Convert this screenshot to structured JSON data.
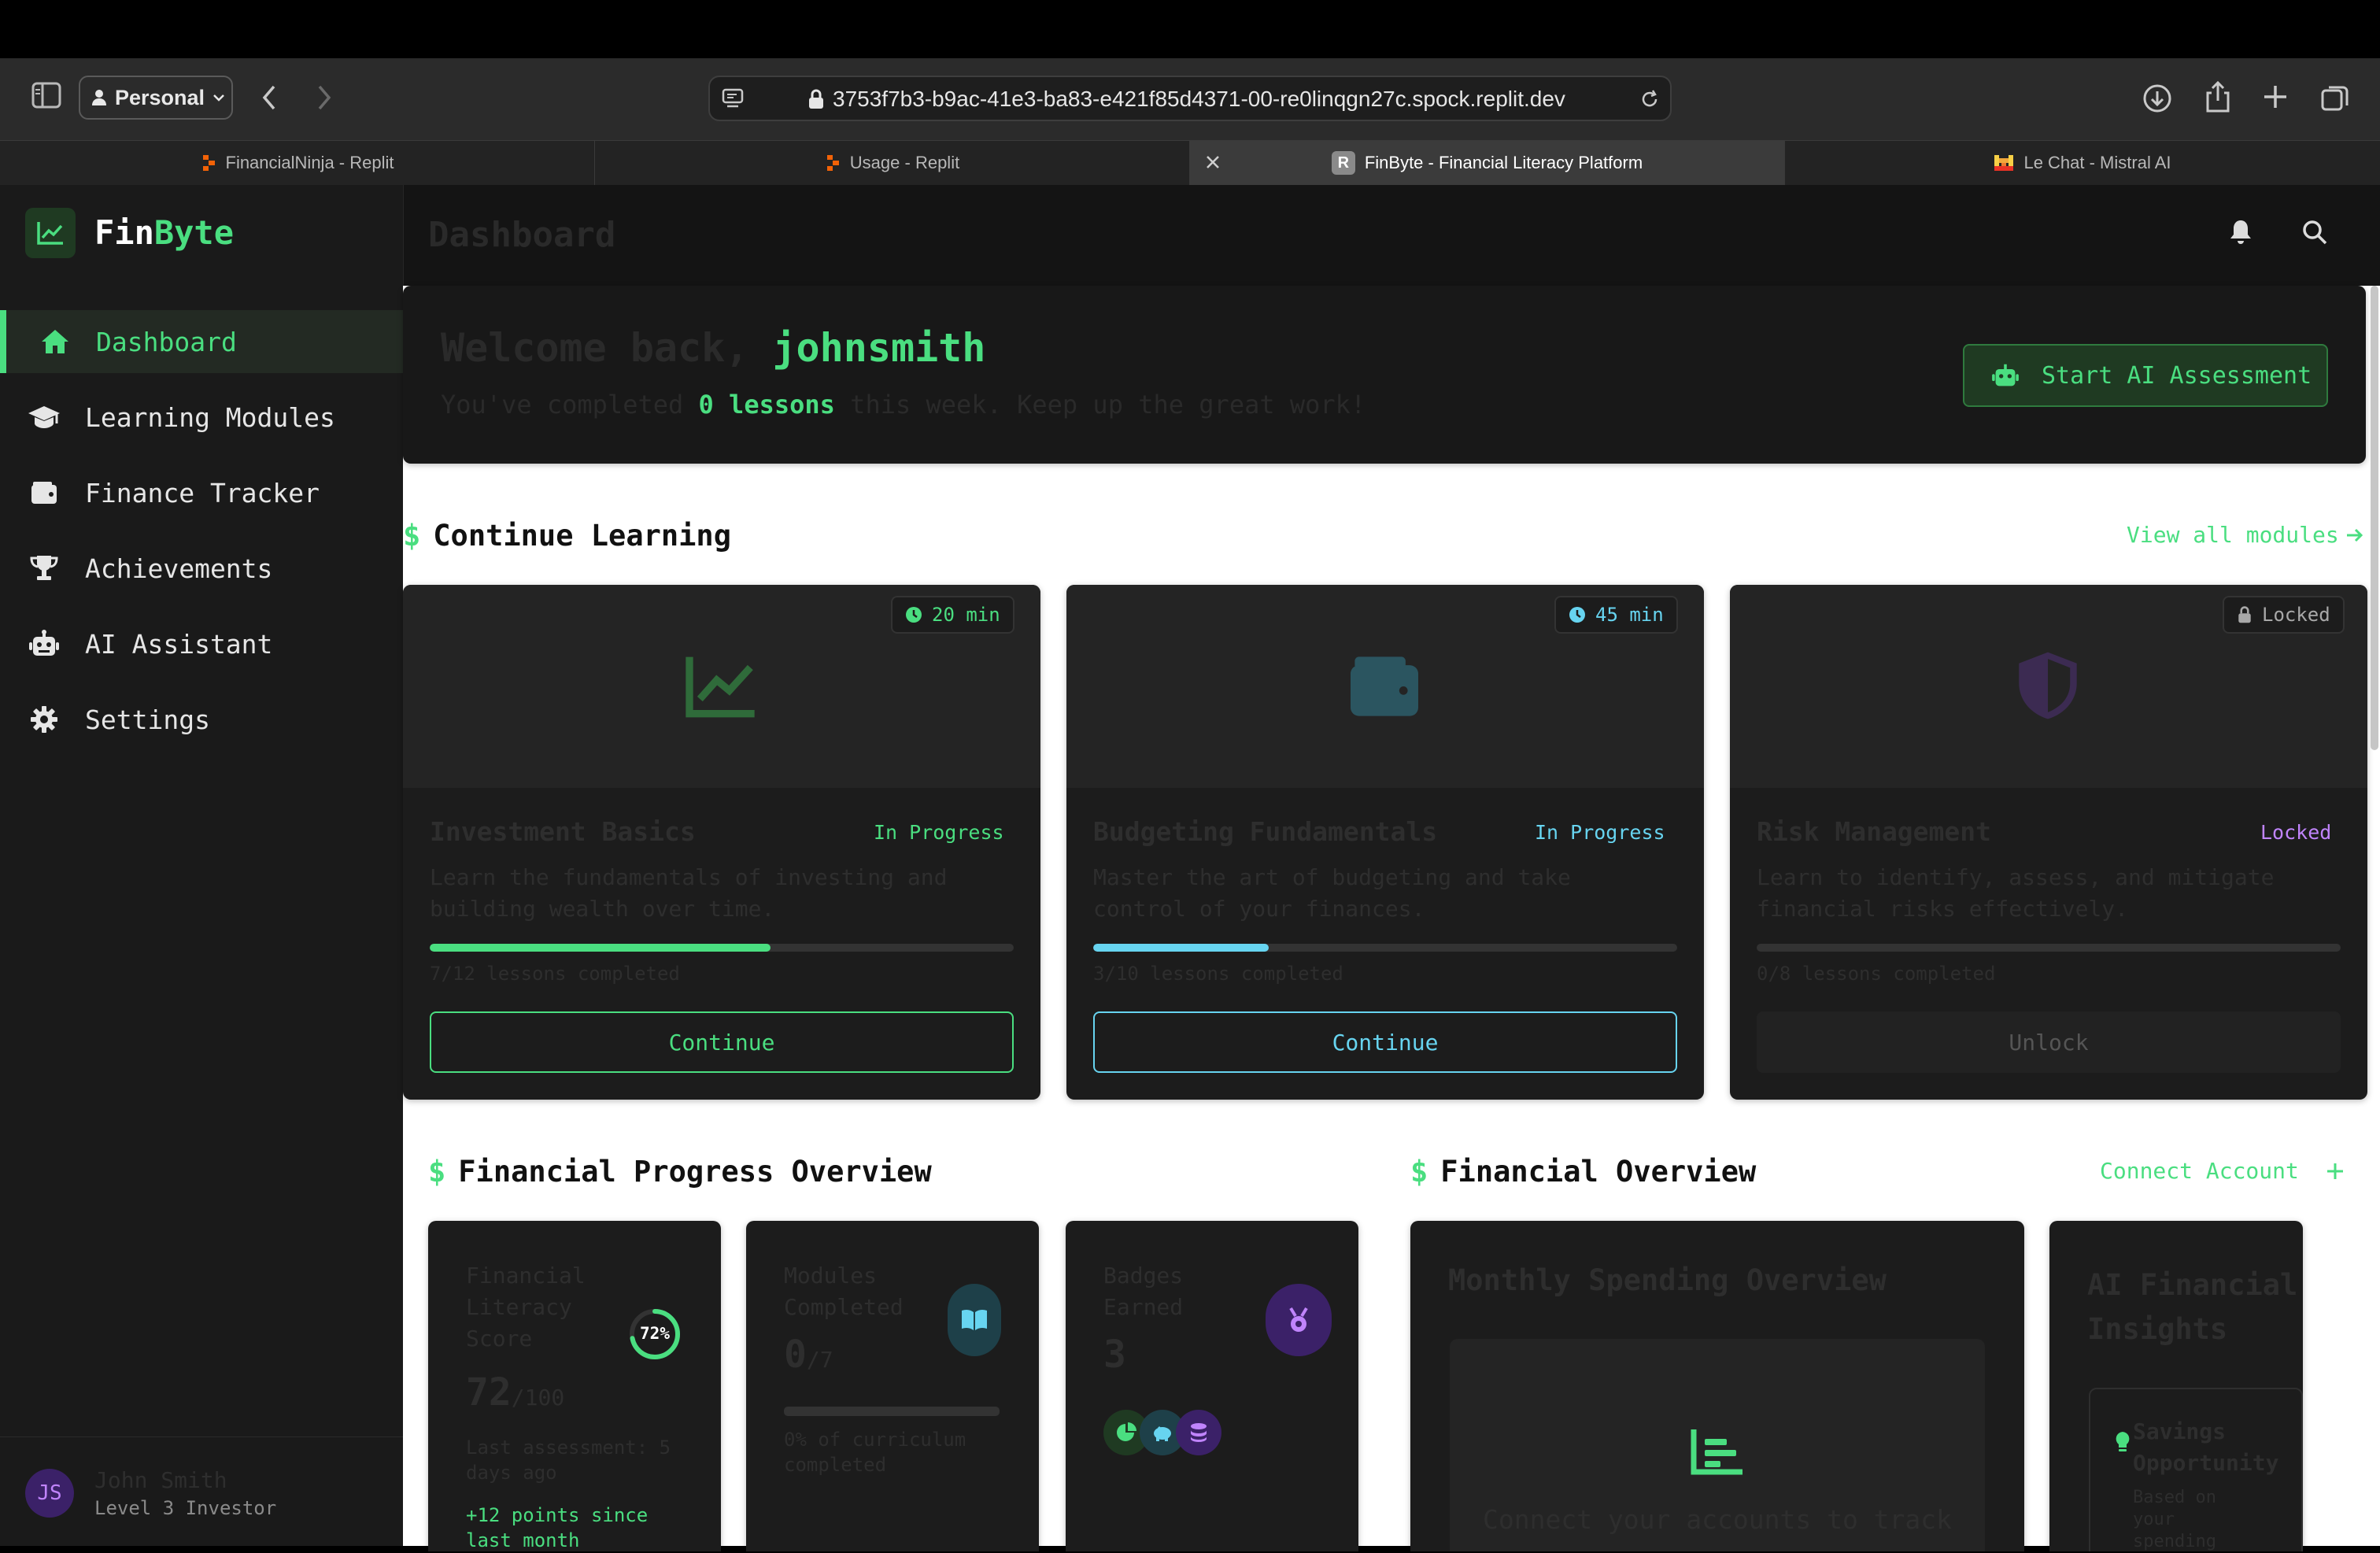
{
  "browser": {
    "profile_label": "Personal",
    "url": "3753f7b3-b9ac-41e3-ba83-e421f85d4371-00-re0linqgn27c.spock.replit.dev",
    "tabs": [
      {
        "label": "FinancialNinja - Replit"
      },
      {
        "label": "Usage - Replit"
      },
      {
        "label": "FinByte - Financial Literacy Platform",
        "favicon": "R"
      },
      {
        "label": "Le Chat - Mistral AI"
      }
    ]
  },
  "brand": {
    "part1": "Fin",
    "part2": "Byte"
  },
  "sidebar": {
    "items": [
      {
        "label": "Dashboard",
        "icon": "home-icon"
      },
      {
        "label": "Learning Modules",
        "icon": "graduation-cap-icon"
      },
      {
        "label": "Finance Tracker",
        "icon": "wallet-icon"
      },
      {
        "label": "Achievements",
        "icon": "trophy-icon"
      },
      {
        "label": "AI Assistant",
        "icon": "robot-icon"
      },
      {
        "label": "Settings",
        "icon": "gear-icon"
      }
    ],
    "user": {
      "initials": "JS",
      "name": "John Smith",
      "level": "Level 3 Investor"
    }
  },
  "header": {
    "title": "Dashboard"
  },
  "welcome": {
    "greeting": "Welcome back,",
    "username": "johnsmith",
    "sub_pre": "You've completed",
    "sub_count": "0 lessons",
    "sub_post": "this week. Keep up the great work!",
    "button": "Start AI Assessment"
  },
  "continue_learning": {
    "title": "Continue Learning",
    "view_all": "View all modules",
    "modules": [
      {
        "badge": "20 min",
        "title": "Investment Basics",
        "status": "In Progress",
        "desc1": "Learn the fundamentals of investing and",
        "desc2": "building wealth over time.",
        "progress": 0.583,
        "lessons": "7/12 lessons completed",
        "button": "Continue",
        "color": "#4ade80",
        "icon": "chart-line-icon"
      },
      {
        "badge": "45 min",
        "title": "Budgeting Fundamentals",
        "status": "In Progress",
        "desc1": "Master the art of budgeting and take",
        "desc2": "control of your finances.",
        "progress": 0.3,
        "lessons": "3/10 lessons completed",
        "button": "Continue",
        "color": "#67d4f0",
        "icon": "wallet-icon"
      },
      {
        "badge": "Locked",
        "title": "Risk Management",
        "status": "Locked",
        "desc1": "Learn to identify, assess, and mitigate",
        "desc2": "financial risks effectively.",
        "progress": 0,
        "lessons": "0/8 lessons completed",
        "button": "Unlock",
        "color": "#c084fc",
        "icon": "shield-icon"
      }
    ]
  },
  "progress_overview": {
    "title": "Financial Progress Overview",
    "literacy": {
      "l1": "Financial",
      "l2": "Literacy",
      "l3": "Score",
      "ring": "72%",
      "score": "72",
      "max": "/100",
      "last1": "Last assessment: 5",
      "last2": "days ago",
      "delta1": "+12 points since",
      "delta2": "last month",
      "value": 0.72
    },
    "modules": {
      "l1": "Modules",
      "l2": "Completed",
      "value": "0",
      "max": "/7",
      "note1": "0% of curriculum",
      "note2": "completed"
    },
    "badges": {
      "l1": "Badges",
      "l2": "Earned",
      "value": "3"
    }
  },
  "financial_overview": {
    "title": "Financial Overview",
    "connect": "Connect Account",
    "spending_title": "Monthly Spending Overview",
    "spending_cta": "Connect your accounts to track",
    "insights_title1": "AI Financial",
    "insights_title2": "Insights",
    "insight_head1": "Savings",
    "insight_head2": "Opportunity",
    "insight_body1": "Based on",
    "insight_body2": "your",
    "insight_body3": "spending"
  }
}
